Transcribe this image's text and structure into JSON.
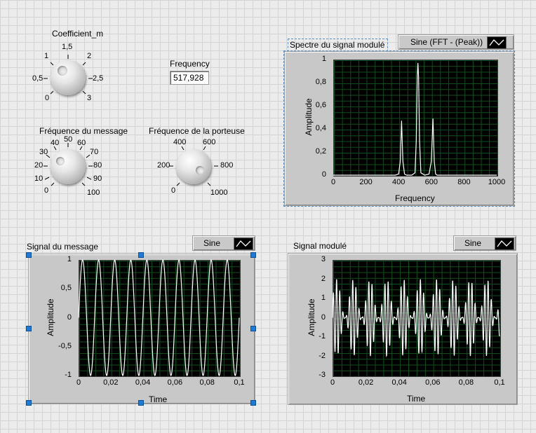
{
  "coefficient_m": {
    "label": "Coefficient_m",
    "ticks": [
      "0",
      "0,5",
      "1",
      "1,5",
      "2",
      "2,5",
      "3"
    ]
  },
  "frequency": {
    "label": "Frequency",
    "value": "517,928"
  },
  "message_freq": {
    "label": "Fréquence du message",
    "ticks": [
      "0",
      "10",
      "20",
      "30",
      "40",
      "50",
      "60",
      "70",
      "80",
      "90",
      "100"
    ]
  },
  "carrier_freq": {
    "label": "Fréquence de la porteuse",
    "ticks": [
      "0",
      "200",
      "400",
      "600",
      "800",
      "1000"
    ]
  },
  "spectrum": {
    "title": "Spectre du signal modulé",
    "legend": "Sine (FFT - (Peak))",
    "ylabel": "Amplitude",
    "xlabel": "Frequency",
    "xticks": [
      "0",
      "200",
      "400",
      "600",
      "800",
      "1000"
    ],
    "yticks": [
      "0",
      "0,2",
      "0,4",
      "0,6",
      "0,8",
      "1"
    ]
  },
  "message_plot": {
    "title": "Signal du message",
    "legend": "Sine",
    "ylabel": "Amplitude",
    "xlabel": "Time",
    "xticks": [
      "0",
      "0,02",
      "0,04",
      "0,06",
      "0,08",
      "0,1"
    ],
    "yticks": [
      "-1",
      "-0,5",
      "0",
      "0,5",
      "1"
    ]
  },
  "modulated_plot": {
    "title": "Signal modulé",
    "legend": "Sine",
    "ylabel": "Amplitude",
    "xlabel": "Time",
    "xticks": [
      "0",
      "0,02",
      "0,04",
      "0,06",
      "0,08",
      "0,1"
    ],
    "yticks": [
      "-3",
      "-2",
      "-1",
      "0",
      "1",
      "2",
      "3"
    ]
  },
  "chart_data": [
    {
      "type": "line",
      "title": "Spectre du signal modulé",
      "xlabel": "Frequency",
      "ylabel": "Amplitude",
      "xlim": [
        0,
        1000
      ],
      "ylim": [
        0,
        1
      ],
      "grid": true,
      "series": [
        {
          "name": "Sine (FFT - (Peak))",
          "x": [
            0,
            380,
            400,
            410,
            418,
            426,
            436,
            450,
            480,
            500,
            508,
            514,
            518,
            522,
            528,
            536,
            560,
            586,
            600,
            610,
            618,
            626,
            636,
            660,
            1000
          ],
          "y": [
            0,
            0,
            0.01,
            0.12,
            0.47,
            0.12,
            0.01,
            0,
            0,
            0.02,
            0.3,
            0.85,
            0.97,
            0.85,
            0.3,
            0.02,
            0,
            0.01,
            0.12,
            0.49,
            0.12,
            0.01,
            0,
            0,
            0
          ]
        }
      ]
    },
    {
      "type": "line",
      "title": "Signal du message",
      "xlabel": "Time",
      "ylabel": "Amplitude",
      "xlim": [
        0,
        0.1
      ],
      "ylim": [
        -1,
        1
      ],
      "grid": true,
      "series": [
        {
          "name": "Sine",
          "function": "sin(2*pi*100*t)",
          "amplitude": 1,
          "frequency_hz": 100,
          "t_range": [
            0,
            0.1
          ]
        }
      ]
    },
    {
      "type": "line",
      "title": "Signal modulé",
      "xlabel": "Time",
      "ylabel": "Amplitude",
      "xlim": [
        0,
        0.1
      ],
      "ylim": [
        -3,
        3
      ],
      "grid": true,
      "series": [
        {
          "name": "Sine",
          "function": "(1 + m*sin(2*pi*fm*t)) * sin(2*pi*fc*t)",
          "m": 1.0,
          "fm_hz": 100,
          "fc_hz": 517.928,
          "t_range": [
            0,
            0.1
          ]
        }
      ]
    }
  ]
}
